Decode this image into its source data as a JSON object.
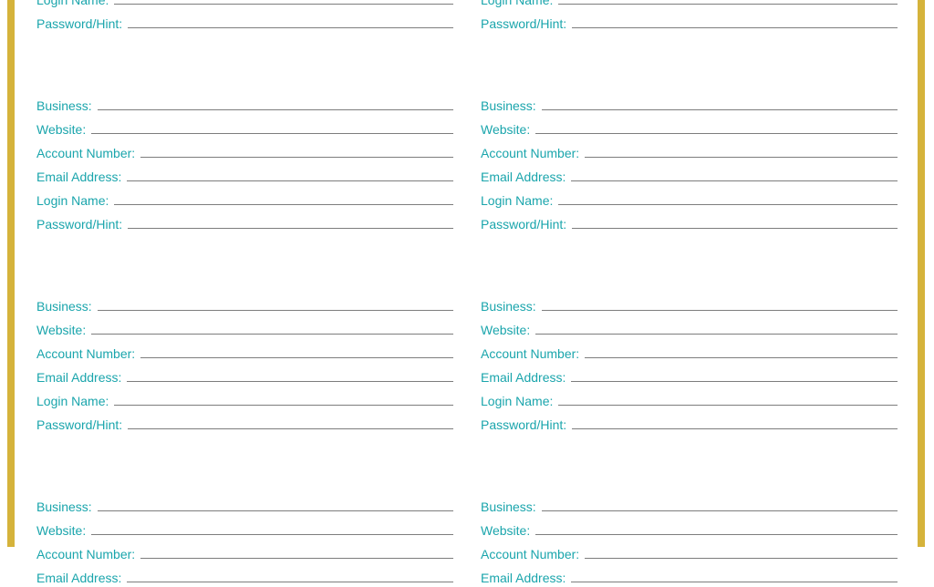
{
  "labels": {
    "business": "Business:",
    "website": "Website:",
    "account_number": "Account Number:",
    "email_address": "Email Address:",
    "login_name": "Login Name:",
    "password_hint": "Password/Hint:"
  },
  "colors": {
    "accent": "#1aa5ac",
    "border": "#d5b33b",
    "line": "#7d7d7d"
  }
}
